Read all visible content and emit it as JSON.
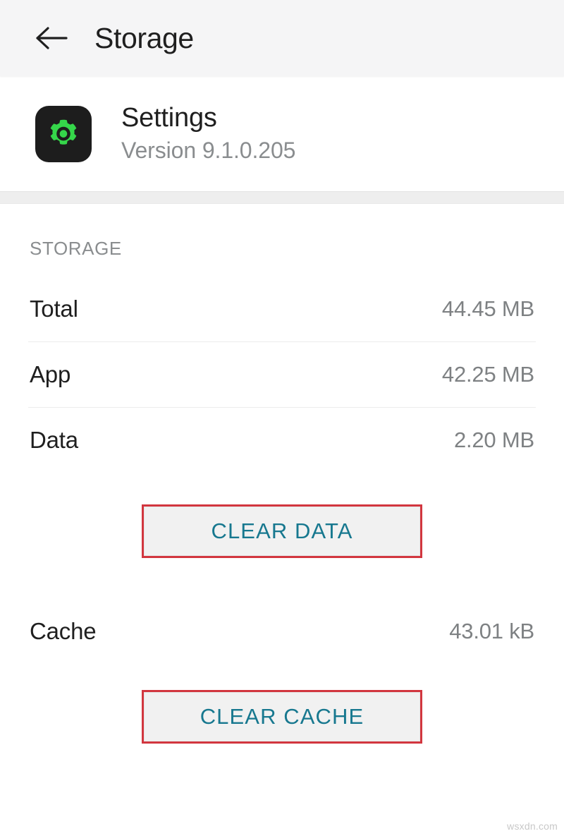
{
  "appbar": {
    "back_icon": "arrow-left-icon",
    "title": "Storage"
  },
  "app_info": {
    "icon": "settings-gear-icon",
    "icon_bg_color": "#1d1d1d",
    "icon_glyph_color": "#35d64a",
    "name": "Settings",
    "version": "Version 9.1.0.205"
  },
  "storage_section": {
    "header": "STORAGE",
    "rows": [
      {
        "label": "Total",
        "value": "44.45 MB"
      },
      {
        "label": "App",
        "value": "42.25 MB"
      },
      {
        "label": "Data",
        "value": "2.20 MB"
      },
      {
        "label": "Cache",
        "value": "43.01 kB"
      }
    ],
    "clear_data_button": "CLEAR DATA",
    "clear_cache_button": "CLEAR CACHE",
    "button_text_color": "#17788f",
    "annotation_color": "#d2363f"
  },
  "watermark": "wsxdn.com"
}
